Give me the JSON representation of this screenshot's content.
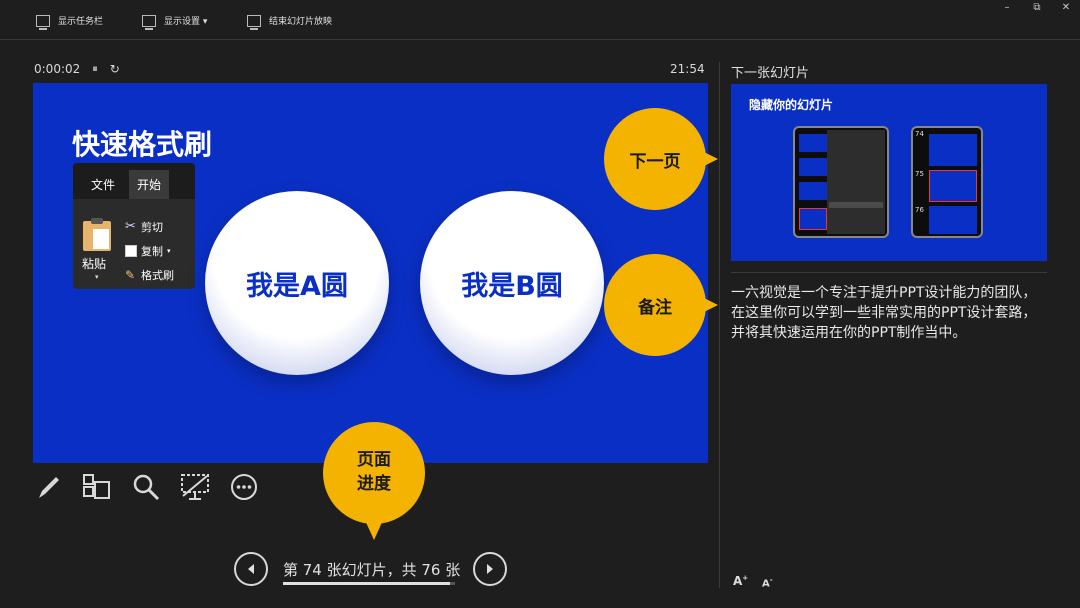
{
  "toolbar": {
    "show_taskbar": "显示任务栏",
    "display_settings": "显示设置 ▾",
    "end_slideshow": "结束幻灯片放映"
  },
  "window_controls": {
    "minimize": "–",
    "restore": "⧉",
    "close": "✕"
  },
  "timer": {
    "elapsed": "0:00:02",
    "pause": "⏸",
    "reset": "↻"
  },
  "clock": "21:54",
  "slide": {
    "title": "快速格式刷",
    "ribbon": {
      "tabs": [
        "文件",
        "开始"
      ],
      "paste": "粘贴",
      "cut": "剪切",
      "copy": "复制",
      "format_painter": "格式刷"
    },
    "circle_a": "我是A圆",
    "circle_b": "我是B圆"
  },
  "callouts": {
    "next_page": "下一页",
    "notes": "备注",
    "page_progress_line1": "页面",
    "page_progress_line2": "进度"
  },
  "navigation": {
    "text": "第 74 张幻灯片，共 76 张",
    "current": 74,
    "total": 76
  },
  "right_panel": {
    "next_slide_label": "下一张幻灯片",
    "next_slide_title": "隐藏你的幻灯片",
    "next_slide_numbers": [
      "74",
      "75",
      "76"
    ],
    "notes": "一六视觉是一个专注于提升PPT设计能力的团队，在这里你可以学到一些非常实用的PPT设计套路，并将其快速运用在你的PPT制作当中。",
    "font_increase": "A",
    "font_decrease": "A"
  },
  "colors": {
    "slide_blue": "#0a2fc5",
    "callout_yellow": "#f5b301",
    "background": "#1e1e1e"
  }
}
